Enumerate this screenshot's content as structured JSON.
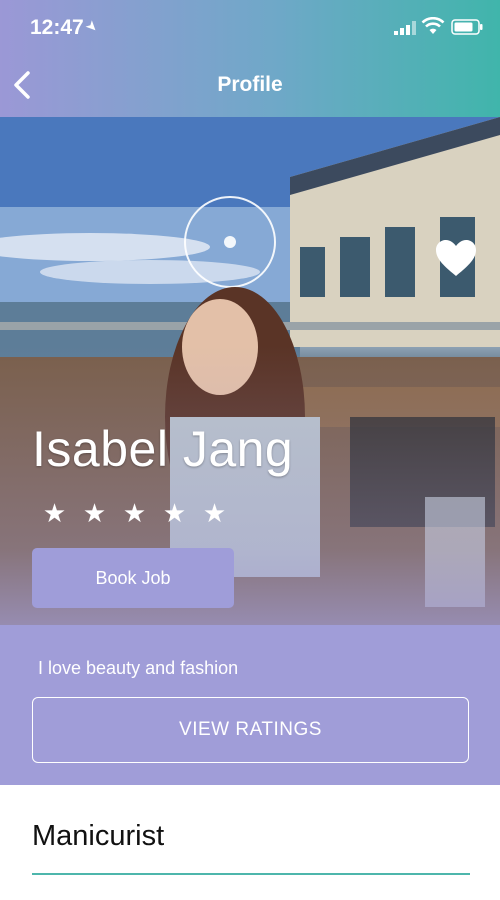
{
  "status_bar": {
    "time": "12:47"
  },
  "header": {
    "title": "Profile"
  },
  "profile": {
    "name": "Isabel Jang",
    "rating": 5,
    "stars": [
      "★",
      "★",
      "★",
      "★",
      "★"
    ],
    "book_label": "Book Job",
    "bio": "I love beauty and fashion",
    "ratings_label": "VIEW RATINGS",
    "profession": "Manicurist",
    "favorited": true
  },
  "icons": {
    "back": "chevron-left-icon",
    "favorite": "heart-icon",
    "location": "location-arrow-icon",
    "signal": "cellular-signal-icon",
    "wifi": "wifi-icon",
    "battery": "battery-icon"
  },
  "colors": {
    "header_gradient_start": "#9b98d6",
    "header_gradient_end": "#40b5ab",
    "accent_purple": "#a09dd8",
    "divider_teal": "#4db6ac"
  }
}
